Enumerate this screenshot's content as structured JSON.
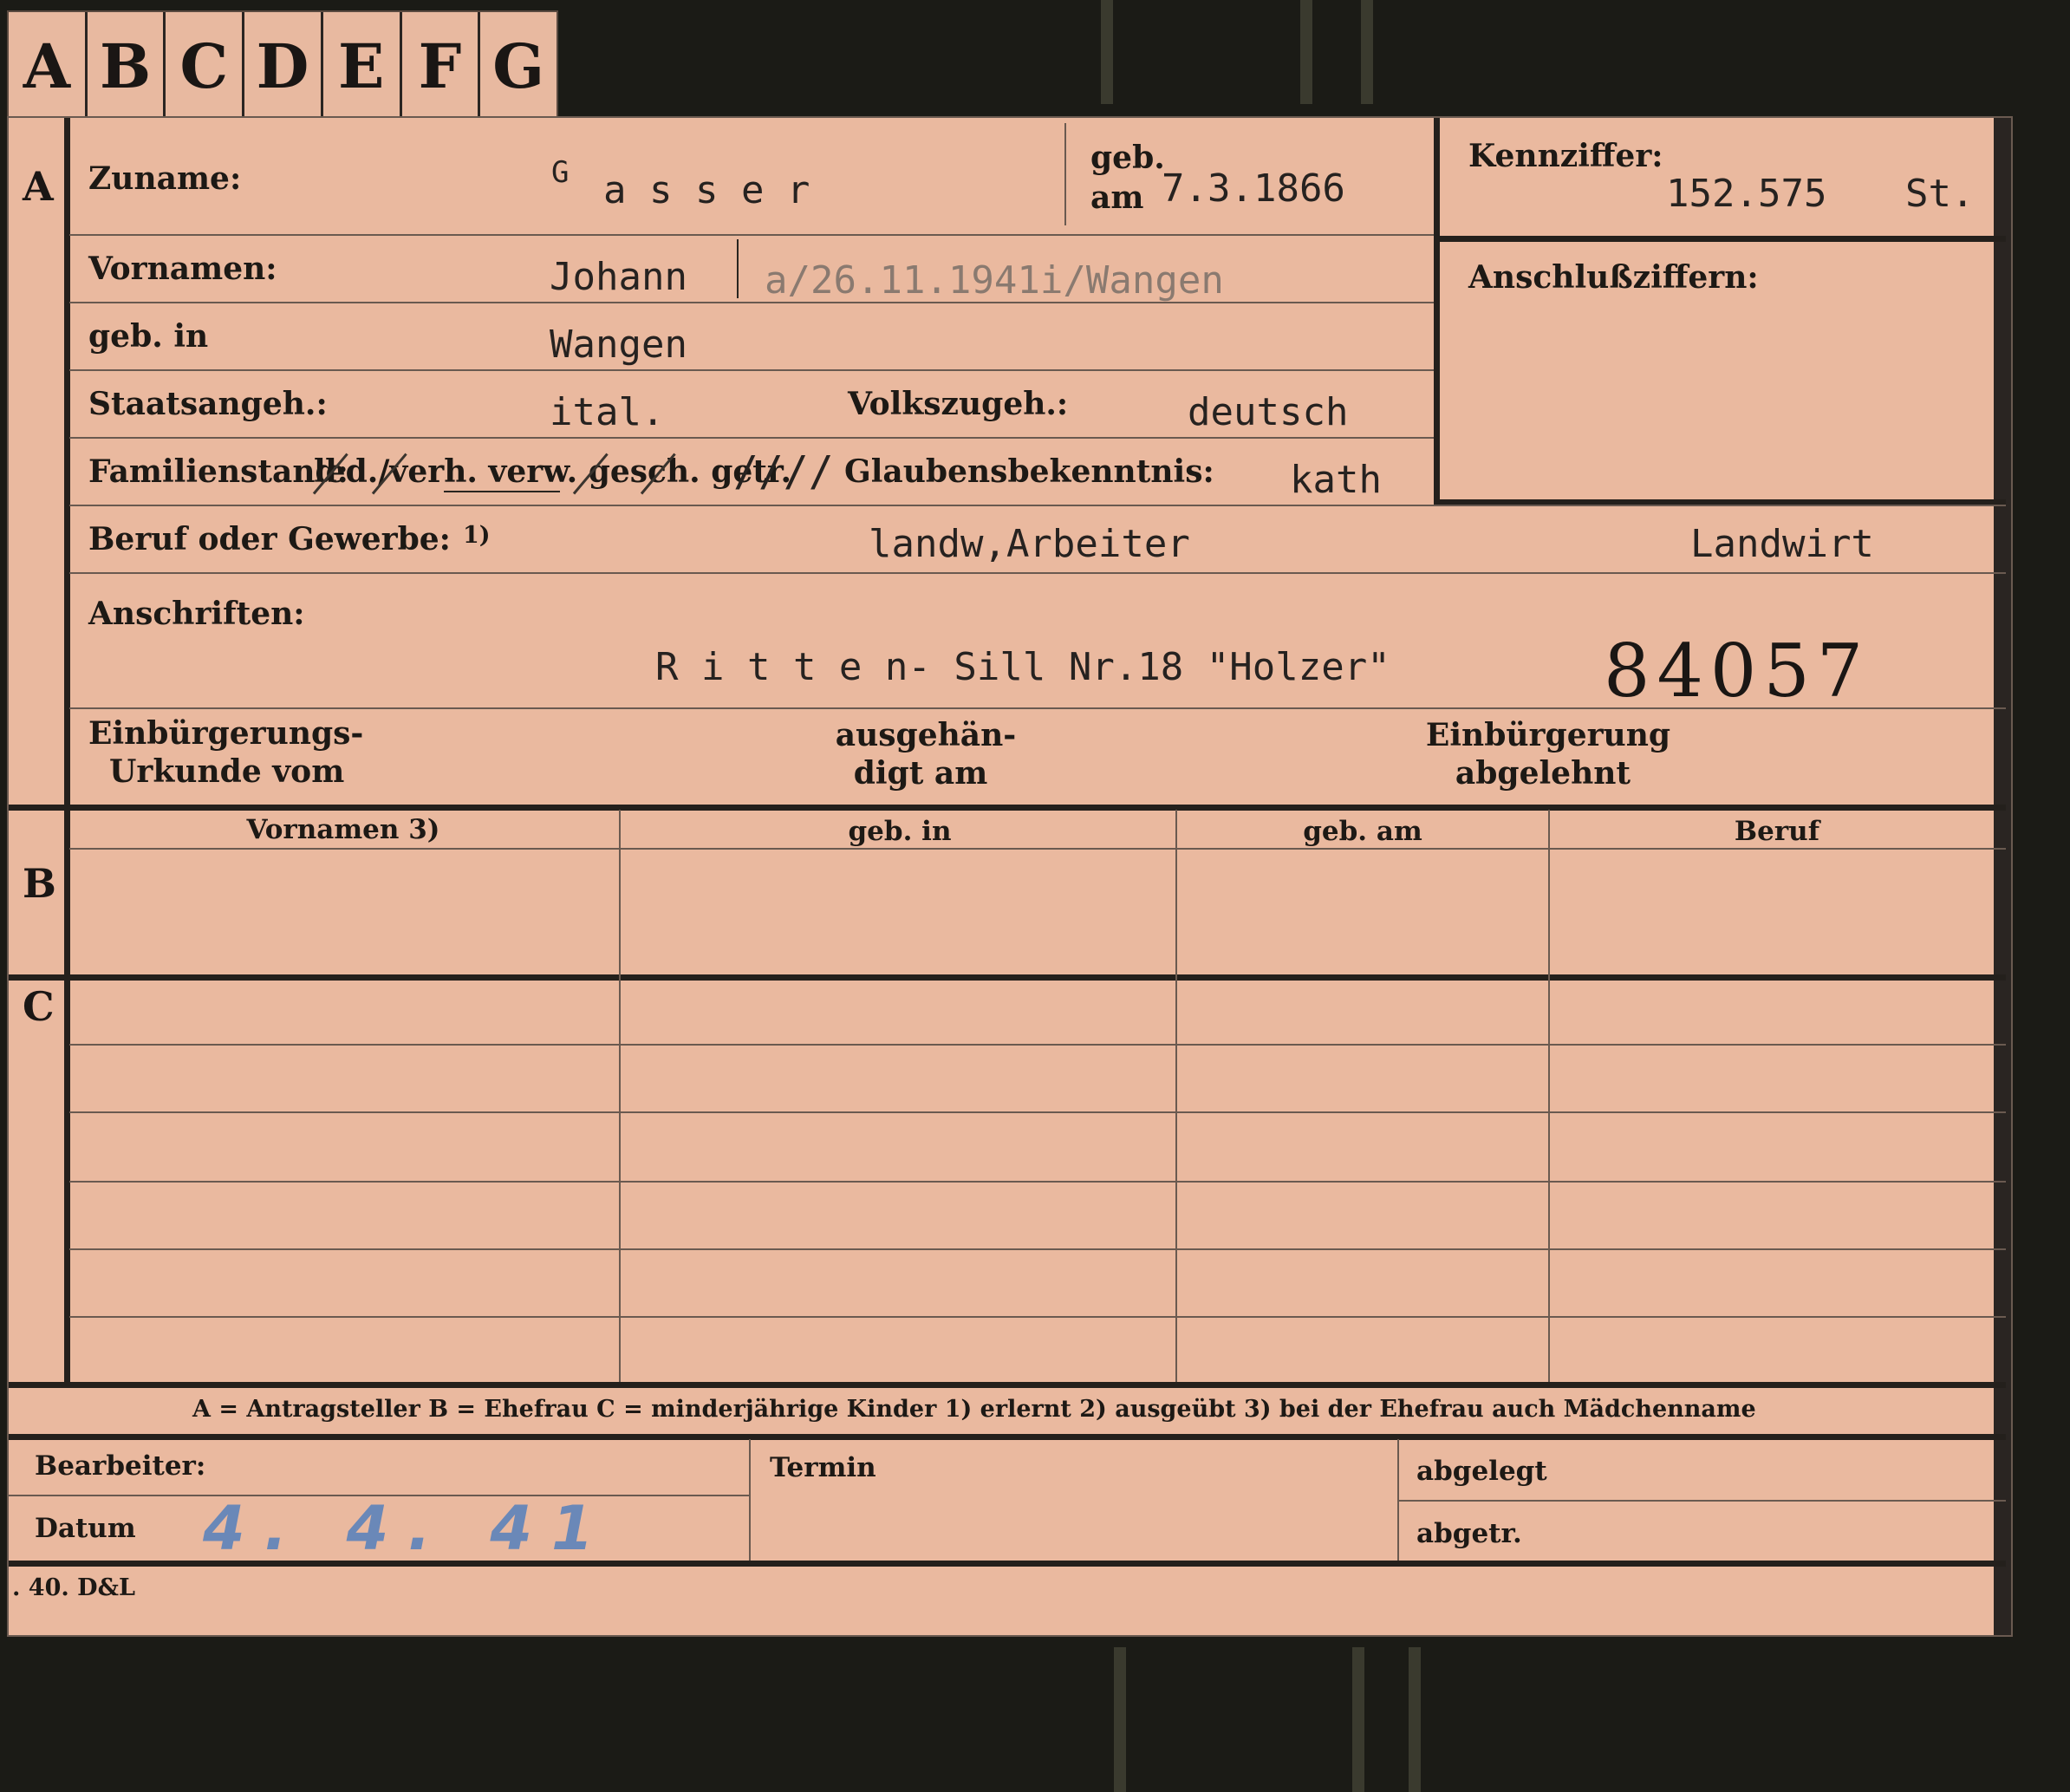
{
  "tabs": [
    "A",
    "B",
    "C",
    "D",
    "E",
    "F",
    "G"
  ],
  "sections": {
    "a": "A",
    "b": "B",
    "c": "C"
  },
  "person": {
    "zuname_label": "Zuname:",
    "zuname_initial": "G",
    "zuname_rest": "a s s e r",
    "geb_label": "geb.",
    "am_label": "am",
    "geb_date": "7.3.1866",
    "vornamen_label": "Vornamen:",
    "vornamen": "Johann",
    "vornamen_note": "a/26.11.1941i/Wangen",
    "geb_in_label": "geb. in",
    "geb_in": "Wangen",
    "staat_label": "Staatsangeh.:",
    "staat": "ital.",
    "volk_label": "Volkszugeh.:",
    "volk": "deutsch",
    "familienstand_label": "Familienstand:",
    "familienstand_options": "led./verh. verw. gesch. getr.",
    "familienstand_strokes": "////",
    "glauben_label": "Glaubensbekenntnis:",
    "glauben": "kath",
    "beruf_label": "Beruf oder Gewerbe:",
    "beruf_note": "1)",
    "beruf_1": "landw,Arbeiter",
    "beruf_2": "Landwirt",
    "anschriften_label": "Anschriften:",
    "anschrift": "R i t t e n- Sill  Nr.18 \"Holzer\"",
    "number": "84057",
    "urkunde_label_1": "Einbürgerungs-",
    "urkunde_label_2": "Urkunde vom",
    "ausgehaendigt_1": "ausgehän-",
    "ausgehaendigt_2": "digt am",
    "abgelehnt_1": "Einbürgerung",
    "abgelehnt_2": "abgelehnt"
  },
  "kennziffer": {
    "label": "Kennziffer:",
    "value": "152.575",
    "suffix": "St.",
    "anschluss_label": "Anschlußziffern:"
  },
  "table": {
    "headers": [
      "Vornamen 3)",
      "geb. in",
      "geb. am",
      "Beruf"
    ]
  },
  "legend": "A = Antragsteller   B = Ehefrau   C = minderjährige Kinder   1) erlernt   2) ausgeübt   3) bei der Ehefrau auch Mädchenname",
  "footer": {
    "bearbeiter_label": "Bearbeiter:",
    "datum_label": "Datum",
    "datum_value": "4. 4. 41",
    "termin_label": "Termin",
    "abgelegt_label": "abgelegt",
    "abgetr_label": "abgetr.",
    "print_code": ". 40. D&L"
  }
}
